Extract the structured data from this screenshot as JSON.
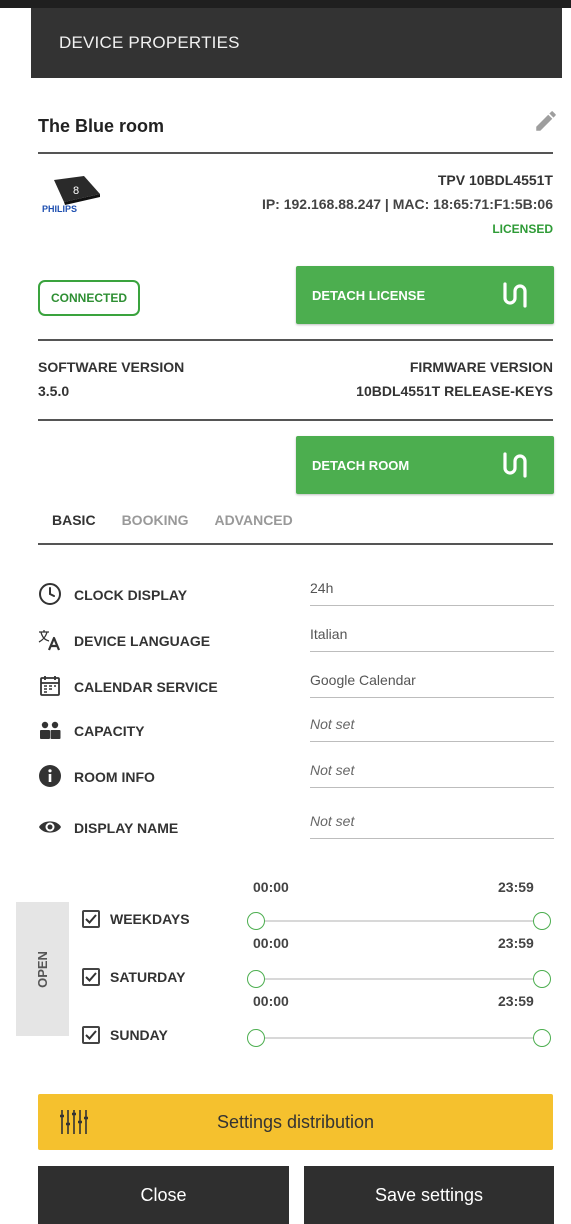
{
  "header": {
    "title": "DEVICE PROPERTIES"
  },
  "room": {
    "name": "The Blue room"
  },
  "device": {
    "logo_number": "8",
    "logo_brand": "PHILIPS",
    "model": "TPV 10BDL4551T",
    "network": "IP: 192.168.88.247 | MAC: 18:65:71:F1:5B:06",
    "license_status": "LICENSED"
  },
  "status": {
    "connection": "CONNECTED"
  },
  "actions": {
    "detach_license": "DETACH LICENSE",
    "detach_room": "DETACH ROOM"
  },
  "versions": {
    "software_label": "SOFTWARE VERSION",
    "software_value": "3.5.0",
    "firmware_label": "FIRMWARE VERSION",
    "firmware_value": "10BDL4551T RELEASE-KEYS"
  },
  "tabs": [
    {
      "label": "BASIC",
      "active": true
    },
    {
      "label": "BOOKING",
      "active": false
    },
    {
      "label": "ADVANCED",
      "active": false
    }
  ],
  "properties": [
    {
      "label": "CLOCK DISPLAY",
      "value": "24h",
      "icon": "clock-icon"
    },
    {
      "label": "DEVICE LANGUAGE",
      "value": "Italian",
      "icon": "translate-icon"
    },
    {
      "label": "CALENDAR SERVICE",
      "value": "Google Calendar",
      "icon": "calendar-icon"
    },
    {
      "label": "CAPACITY",
      "value": "Not set",
      "icon": "people-icon"
    },
    {
      "label": "ROOM INFO",
      "value": "Not set",
      "icon": "info-icon"
    },
    {
      "label": "DISPLAY NAME",
      "value": "Not set",
      "icon": "eye-icon"
    }
  ],
  "opening_hours": {
    "label": "OPEN",
    "days": [
      {
        "name": "WEEKDAYS",
        "checked": true,
        "start": "00:00",
        "end": "23:59"
      },
      {
        "name": "SATURDAY",
        "checked": true,
        "start": "00:00",
        "end": "23:59"
      },
      {
        "name": "SUNDAY",
        "checked": true,
        "start": "00:00",
        "end": "23:59"
      }
    ]
  },
  "distribution": {
    "label": "Settings distribution"
  },
  "footer": {
    "close_label": "Close",
    "save_label": "Save settings"
  },
  "colors": {
    "header_bg": "#333333",
    "accent_green": "#4cae4f",
    "warning_yellow": "#f5c12e",
    "button_dark": "#2f2f2f"
  }
}
